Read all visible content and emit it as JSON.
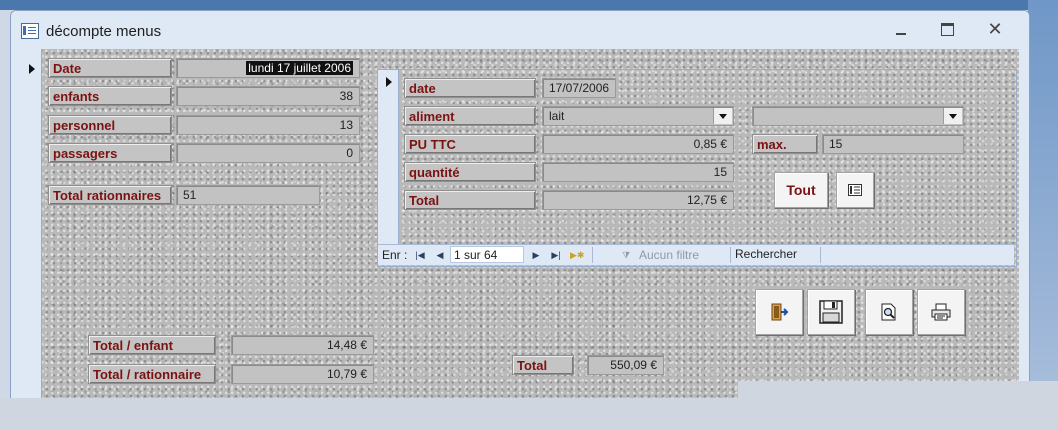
{
  "window": {
    "title": "décompte menus",
    "icon": "form-icon",
    "controls": [
      "minimize-icon",
      "maximize-icon",
      "close-icon"
    ],
    "close_glyph": "✕"
  },
  "main": {
    "fields": [
      {
        "label": "Date",
        "value": "lundi 17 juillet 2006"
      },
      {
        "label": "enfants",
        "value": "38"
      },
      {
        "label": "personnel",
        "value": "13"
      },
      {
        "label": "passagers",
        "value": "0"
      }
    ],
    "total_rationnaires": {
      "label": "Total rationnaires",
      "value": "51"
    },
    "total_enfant": {
      "label": "Total / enfant",
      "value": "14,48 €"
    },
    "total_par_rationnaire": {
      "label": "Total / rationnaire",
      "value": "10,79 €"
    },
    "grand_total": {
      "label": "Total",
      "value": "550,09 €"
    }
  },
  "subform": {
    "date": {
      "label": "date",
      "value": "17/07/2006"
    },
    "aliment": {
      "label": "aliment",
      "value": "lait",
      "second_value": ""
    },
    "pu_ttc": {
      "label": "PU TTC",
      "value": "0,85 €"
    },
    "max": {
      "label": "max.",
      "value": "15"
    },
    "quantite": {
      "label": "quantité",
      "value": "15"
    },
    "total": {
      "label": "Total",
      "value": "12,75 €"
    },
    "tout_button": "Tout",
    "nav": {
      "prefix": "Enr :",
      "record": "1 sur 64",
      "filter": "Aucun filtre",
      "search": "Rechercher"
    }
  },
  "toolbar_icons": [
    "exit-door-icon",
    "save-disk-icon",
    "print-preview-icon",
    "printer-icon"
  ]
}
